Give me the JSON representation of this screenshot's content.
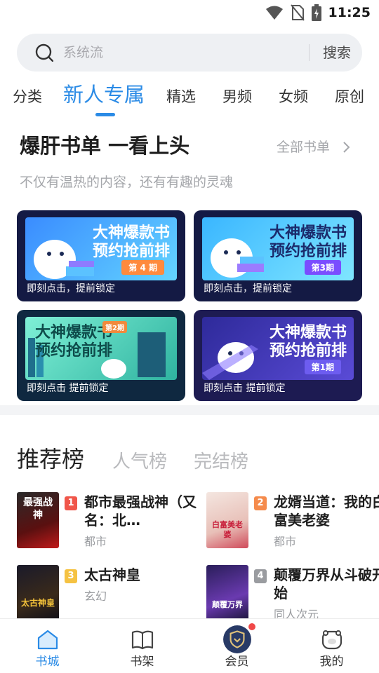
{
  "status_bar": {
    "time": "11:25",
    "icons": [
      "wifi-icon",
      "no-sim-icon",
      "battery-charging-icon"
    ]
  },
  "search": {
    "placeholder": "系统流",
    "button_label": "搜索"
  },
  "tabs": [
    {
      "label": "分类",
      "active": false
    },
    {
      "label": "新人专属",
      "active": true
    },
    {
      "label": "精选",
      "active": false
    },
    {
      "label": "男频",
      "active": false
    },
    {
      "label": "女频",
      "active": false
    },
    {
      "label": "原创",
      "active": false
    }
  ],
  "booklist_section": {
    "title": "爆肝书单 一看上头",
    "see_all": "全部书单",
    "subtitle": "不仅有温热的内容，还有有趣的灵魂",
    "cards": [
      {
        "banner_line1": "大神爆款书",
        "banner_line2": "预约抢前排",
        "issue": "第 4 期",
        "caption": "即刻点击，提前锁定",
        "bg": "#15193b",
        "accent": "#4aa3ff"
      },
      {
        "banner_line1": "大神爆款书",
        "banner_line2": "预约抢前排",
        "issue": "第3期",
        "caption": "即刻点击，提前锁定",
        "bg": "#15193b",
        "accent": "#3dc3ff"
      },
      {
        "banner_line1": "大神爆款书",
        "banner_line2": "预约抢前排",
        "issue": "第2期",
        "caption": "即刻点击 提前锁定",
        "bg": "#0e2a3a",
        "accent": "#3fd9b2"
      },
      {
        "banner_line1": "大神爆款书",
        "banner_line2": "预约抢前排",
        "issue": "第1期",
        "caption": "即刻点击 提前锁定",
        "bg": "#1c1a4e",
        "accent": "#6b6bff"
      }
    ]
  },
  "ranking": {
    "tabs": [
      {
        "label": "推荐榜",
        "active": true
      },
      {
        "label": "人气榜",
        "active": false
      },
      {
        "label": "完结榜",
        "active": false
      }
    ],
    "books": [
      {
        "rank": "1",
        "title": "都市最强战神（又名：北…",
        "genre": "都市",
        "badge_color": "#f0564a",
        "cover_text": "最强战神"
      },
      {
        "rank": "2",
        "title": "龙婿当道：我的白富美老婆",
        "genre": "都市",
        "badge_color": "#f58b4c",
        "cover_text": "白富美老婆"
      },
      {
        "rank": "3",
        "title": "太古神皇",
        "genre": "玄幻",
        "badge_color": "#f5c242",
        "cover_text": "太古神皇"
      },
      {
        "rank": "4",
        "title": "颠覆万界从斗破开始",
        "genre": "同人次元",
        "badge_color": "#9a9ca0",
        "cover_text": "颠覆万界"
      }
    ]
  },
  "bottom_nav": [
    {
      "label": "书城",
      "icon": "home-icon",
      "active": true
    },
    {
      "label": "书架",
      "icon": "book-icon",
      "active": false
    },
    {
      "label": "会员",
      "icon": "vip-shield-icon",
      "active": false,
      "badge": true
    },
    {
      "label": "我的",
      "icon": "profile-icon",
      "active": false
    }
  ],
  "colors": {
    "accent": "#2b8be6",
    "badge_red": "#f04848"
  }
}
